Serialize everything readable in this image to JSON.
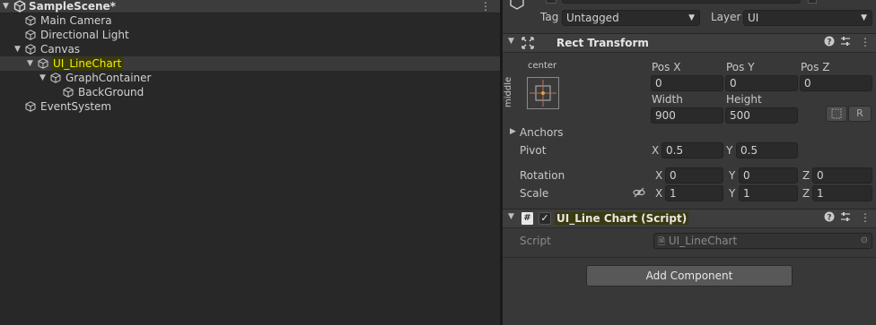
{
  "hierarchy": {
    "scene": {
      "title": "SampleScene*"
    },
    "items": [
      {
        "label": "Main Camera"
      },
      {
        "label": "Directional Light"
      },
      {
        "label": "Canvas"
      },
      {
        "label": "UI_LineChart"
      },
      {
        "label": "GraphContainer"
      },
      {
        "label": "BackGround"
      },
      {
        "label": "EventSystem"
      }
    ]
  },
  "inspector": {
    "top": {
      "tag_label": "Tag",
      "tag_value": "Untagged",
      "layer_label": "Layer",
      "layer_value": "UI"
    },
    "rect_transform": {
      "title": "Rect Transform",
      "anchor_preset_h": "center",
      "anchor_preset_v": "middle",
      "pos_x_label": "Pos X",
      "pos_y_label": "Pos Y",
      "pos_z_label": "Pos Z",
      "pos_x": "0",
      "pos_y": "0",
      "pos_z": "0",
      "width_label": "Width",
      "height_label": "Height",
      "width": "900",
      "height": "500",
      "r_button": "R",
      "anchors_label": "Anchors",
      "pivot_label": "Pivot",
      "pivot_x": "0.5",
      "pivot_y": "0.5",
      "rotation_label": "Rotation",
      "rot_x": "0",
      "rot_y": "0",
      "rot_z": "0",
      "scale_label": "Scale",
      "scale_x": "1",
      "scale_y": "1",
      "scale_z": "1",
      "x": "X",
      "y": "Y",
      "z": "Z"
    },
    "script_component": {
      "title": "UI_Line Chart (Script)",
      "script_label": "Script",
      "script_value": "UI_LineChart"
    },
    "add_component": "Add Component"
  },
  "colors": {
    "highlight_text": "#f0f000",
    "panel_bg": "#383838",
    "hierarchy_bg": "#282828"
  }
}
